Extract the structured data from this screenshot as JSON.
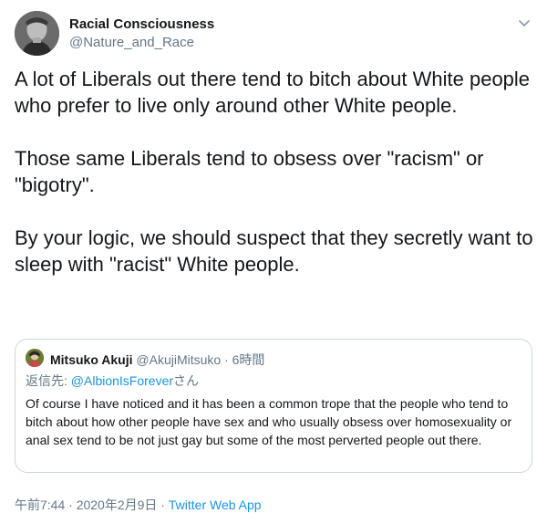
{
  "author": {
    "display_name": "Racial Consciousness",
    "handle": "@Nature_and_Race"
  },
  "tweet": {
    "text": "A lot of Liberals out there tend to bitch about White people who prefer to live only around other White people.\n\nThose same Liberals tend to obsess over \"racism\" or \"bigotry\".\n\nBy your logic, we should suspect that they secretly want to sleep with \"racist\" White people."
  },
  "quoted_tweet": {
    "display_name": "Mitsuko Akuji",
    "handle": "@AkujiMitsuko",
    "separator": "·",
    "time": "6時間",
    "reply_prefix": "返信先: ",
    "reply_mention": "@AlbionIsForever",
    "reply_suffix": "さん",
    "text": "Of course I have noticed and it has been a common trope that the people who tend to bitch about how other people have sex and who usually obsess over homosexuality or anal sex tend to be not just gay but some of the most perverted people out there."
  },
  "meta": {
    "time": "午前7:44",
    "separator1": " · ",
    "date": "2020年2月9日",
    "separator2": " · ",
    "source": "Twitter Web App"
  },
  "colors": {
    "link": "#1b95e0",
    "secondary_text": "#657786",
    "border": "#ccd6dd"
  },
  "icons": {
    "caret": "chevron-down-icon"
  }
}
